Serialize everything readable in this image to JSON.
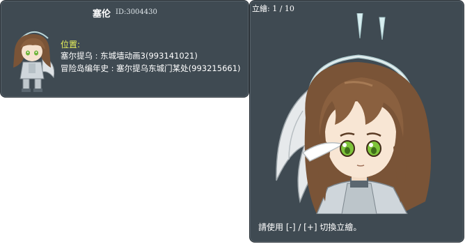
{
  "npc": {
    "name": "塞伦",
    "id_text": "ID:3004430"
  },
  "location": {
    "label": "位置:",
    "lines": [
      "塞尔提乌 : 东城墙动画3(993141021)",
      "冒险岛编年史 : 塞尔提乌东城门某处(993215661)"
    ]
  },
  "illustration": {
    "counter": "立繪: 1 / 10",
    "hint": "請使用 [-] / [+] 切換立繪。"
  },
  "colors": {
    "panel_bg": "#3f4a52",
    "label_yellow": "#e8f25a",
    "hair": "#7a5437",
    "eyes": "#7ec43a",
    "halo": "#c9e8ea"
  },
  "icons": {
    "mini_character": "chibi-npc-sprite",
    "portrait": "npc-portrait-illustration"
  }
}
